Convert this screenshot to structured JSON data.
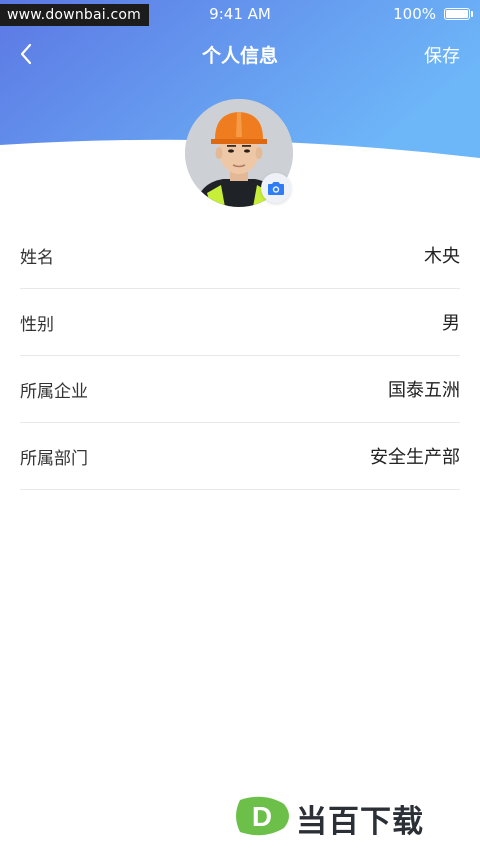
{
  "watermark_top": "www.downbai.com",
  "status_bar": {
    "time": "9:41 AM",
    "battery": "100%"
  },
  "nav": {
    "title": "个人信息",
    "save_label": "保存",
    "back_icon": "chevron-left-icon"
  },
  "profile": {
    "avatar_alt": "worker-avatar",
    "camera_icon": "camera-icon"
  },
  "fields": [
    {
      "label": "姓名",
      "value": "木央"
    },
    {
      "label": "性别",
      "value": "男"
    },
    {
      "label": "所属企业",
      "value": "国泰五洲"
    },
    {
      "label": "所属部门",
      "value": "安全生产部"
    }
  ],
  "watermark_bottom": {
    "logo_letter": "D",
    "text": "当百下载"
  },
  "colors": {
    "header_gradient_start": "#5a7be6",
    "header_gradient_end": "#6fb3f7",
    "accent": "#2f7df6",
    "divider": "#e8e8e8",
    "logo_green": "#6cc04a"
  }
}
